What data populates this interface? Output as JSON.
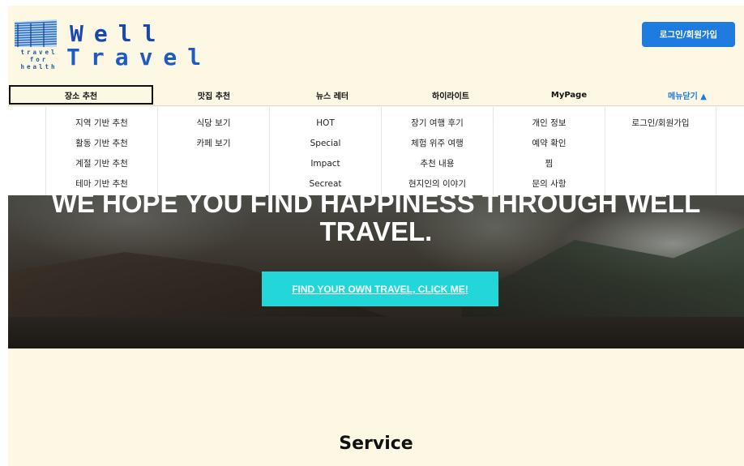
{
  "logo": {
    "small_line1": "travel",
    "small_line2": "for",
    "small_line3": "health",
    "big_line1": "Well",
    "big_line2": "Travel"
  },
  "header": {
    "login_button": "로그인/회원가입"
  },
  "nav": {
    "items": [
      {
        "label": "장소 추천"
      },
      {
        "label": "맛집 추천"
      },
      {
        "label": "뉴스 레터"
      },
      {
        "label": "하이라이트"
      },
      {
        "label": "MyPage"
      },
      {
        "label": "메뉴닫기 ▲"
      }
    ]
  },
  "dropdown": {
    "columns": [
      {
        "items": [
          "지역 기반 추천",
          "활동 기반 추천",
          "계절 기반 추천",
          "테마 기반 추천"
        ]
      },
      {
        "items": [
          "식당 보기",
          "카페 보기"
        ]
      },
      {
        "items": [
          "HOT",
          "Special",
          "Impact",
          "Secreat"
        ]
      },
      {
        "items": [
          "장기 여행 후기",
          "체험 위주 여행",
          "추천 내용",
          "현지인의 이야기"
        ]
      },
      {
        "items": [
          "개인 정보",
          "예약 확인",
          "찜",
          "문의 사항"
        ]
      },
      {
        "items": [
          "로그인/회원가입"
        ]
      }
    ]
  },
  "hero": {
    "title_line1": "WE HOPE YOU FIND HAPPINESS THROUGH WELL",
    "title_line2": "TRAVEL.",
    "cta": "FIND YOUR OWN TRAVEL, CLICK ME!"
  },
  "service": {
    "heading": "Service"
  },
  "colors": {
    "page_bg": "#fdf8e3",
    "accent_blue": "#1e7be0",
    "cta_cyan": "#23d6d8",
    "logo_blue": "#1848b6"
  }
}
